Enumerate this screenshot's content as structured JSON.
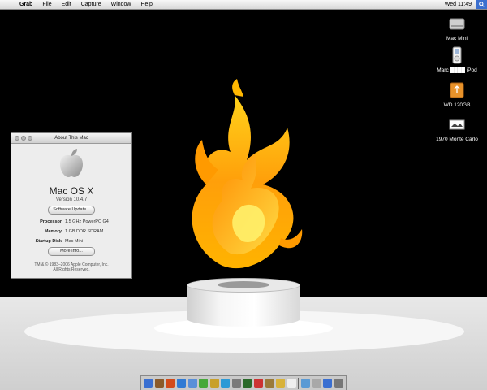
{
  "menubar": {
    "app": "Grab",
    "items": [
      "File",
      "Edit",
      "Capture",
      "Window",
      "Help"
    ],
    "clock": "Wed 11:49"
  },
  "desktop_icons": [
    {
      "label": "Mac Mini",
      "icon": "hard-drive-icon"
    },
    {
      "label": "Marc ████ iPod",
      "icon": "ipod-icon"
    },
    {
      "label": "WD 120GB",
      "icon": "external-drive-icon"
    },
    {
      "label": "1970 Monte Carlo",
      "icon": "image-file-icon"
    }
  ],
  "about_window": {
    "title": "About This Mac",
    "os_name": "Mac OS X",
    "version": "Version 10.4.7",
    "software_update_label": "Software Update...",
    "specs": [
      {
        "key": "Processor",
        "value": "1.5 GHz PowerPC G4"
      },
      {
        "key": "Memory",
        "value": "1 GB DDR SDRAM"
      },
      {
        "key": "Startup Disk",
        "value": "Mac Mini"
      }
    ],
    "more_info_label": "More Info...",
    "copyright_line1": "TM & © 1983–2006 Apple Computer, Inc.",
    "copyright_line2": "All Rights Reserved."
  },
  "dock": {
    "colors": [
      "#3a6fd1",
      "#8a5a2a",
      "#d24a1a",
      "#2f7ad4",
      "#5a8fd8",
      "#46a83a",
      "#c8a02a",
      "#2b9ad6",
      "#7a7a7a",
      "#2a6a2a",
      "#c33",
      "#9a7a3a",
      "#d8b23a",
      "#eee",
      "#5a9ad4",
      "#a8a8a8",
      "#3a6fd1",
      "#777"
    ]
  }
}
